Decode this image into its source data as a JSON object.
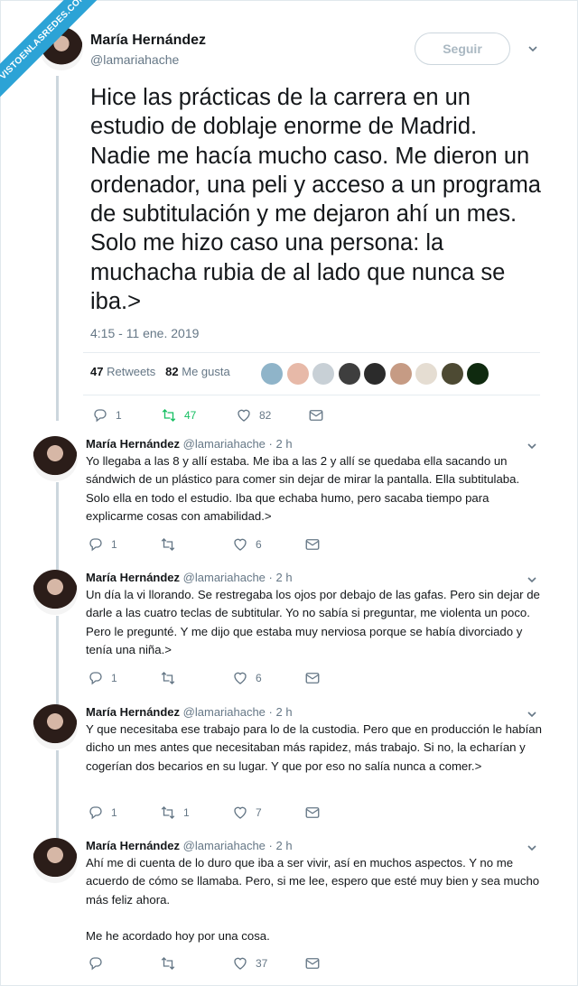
{
  "watermark": "VISTOENLASREDES.COM",
  "main_tweet": {
    "author_name": "María Hernández",
    "author_handle": "@lamariahache",
    "follow_label": "Seguir",
    "text": "Hice las prácticas de la carrera en un estudio de doblaje enorme de Madrid. Nadie me hacía mucho caso. Me dieron un ordenador, una peli y acceso a un programa de subtitulación y me dejaron ahí un mes. Solo me hizo caso una persona: la muchacha rubia de al lado que nunca se iba.>",
    "timestamp": "4:15 - 11 ene. 2019",
    "retweets_count": "47",
    "retweets_label": "Retweets",
    "likes_count": "82",
    "likes_label": "Me gusta",
    "replies": "1",
    "rt": "47",
    "likes": "82"
  },
  "replies": [
    {
      "name": "María Hernández",
      "handle": "@lamariahache",
      "time": "· 2 h",
      "text": "Yo llegaba a las 8 y allí estaba. Me iba a las 2 y allí se quedaba ella sacando un sándwich de un plástico para comer sin dejar de mirar la pantalla. Ella subtitulaba. Solo ella en todo el estudio. Iba que echaba humo, pero sacaba tiempo para explicarme cosas con amabilidad.>",
      "replies": "1",
      "rt": "",
      "likes": "6"
    },
    {
      "name": "María Hernández",
      "handle": "@lamariahache",
      "time": "· 2 h",
      "text": "Un día la vi llorando. Se restregaba los ojos por debajo de las gafas. Pero sin dejar de darle a las cuatro teclas de subtitular. Yo no sabía si preguntar, me violenta un poco. Pero le pregunté. Y me dijo que estaba muy nerviosa porque se había divorciado y tenía una niña.>",
      "replies": "1",
      "rt": "",
      "likes": "6"
    },
    {
      "name": "María Hernández",
      "handle": "@lamariahache",
      "time": "· 2 h",
      "text": "Y que necesitaba ese trabajo para lo de la custodia. Pero que en producción le habían dicho un mes antes que necesitaban más rapidez, más trabajo. Si no, la echarían y cogerían dos becarios en su lugar. Y que por eso no salía nunca a comer.>",
      "replies": "1",
      "rt": "1",
      "likes": "7"
    },
    {
      "name": "María Hernández",
      "handle": "@lamariahache",
      "time": "· 2 h",
      "text": "Ahí me di cuenta de lo duro que iba a ser vivir, así en muchos aspectos. Y no me acuerdo de cómo se llamaba. Pero, si me lee, espero que esté muy bien y sea mucho más feliz ahora.\n\nMe he acordado hoy por una cosa.",
      "replies": "",
      "rt": "",
      "likes": "37"
    }
  ],
  "icons": {
    "reply": "reply-icon",
    "retweet": "retweet-icon",
    "like": "heart-icon",
    "dm": "envelope-icon",
    "caret": "chevron-down-icon"
  },
  "colors": {
    "ribbon": "#2ca3d6",
    "retweet_active": "#17bf63",
    "muted": "#657786"
  }
}
